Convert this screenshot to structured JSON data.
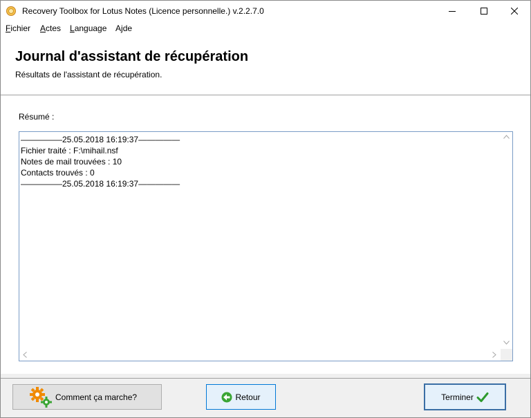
{
  "window": {
    "title": "Recovery Toolbox for Lotus Notes (Licence personnelle.) v.2.2.7.0"
  },
  "menu": [
    {
      "label": "Fichier",
      "accel": "F",
      "rest": "ichier"
    },
    {
      "label": "Actes",
      "accel": "A",
      "rest": "ctes"
    },
    {
      "label": "Language",
      "accel": "L",
      "rest": "anguage"
    },
    {
      "label": "Ajde",
      "accel": "j",
      "pre": "A",
      "rest": "de"
    }
  ],
  "header": {
    "title": "Journal d'assistant de récupération",
    "subtitle": "Résultats de l'assistant de récupération."
  },
  "summary": {
    "label": "Résumé :",
    "lines": [
      "—————25.05.2018 16:19:37—————",
      "Fichier traité : F:\\mihail.nsf",
      "Notes de mail trouvées : 10",
      "Contacts trouvés : 0",
      "—————25.05.2018 16:19:37—————"
    ]
  },
  "buttons": {
    "how_it_works": "Comment ça marche?",
    "back": "Retour",
    "finish": "Terminer"
  },
  "icons": {
    "app": "lotus-notes-app-icon",
    "how_it_works": "gears-icon",
    "back": "green-back-arrow-icon",
    "finish": "green-checkmark-icon"
  },
  "colors": {
    "log_border": "#7a9cc6",
    "focus_border": "#3a6ea5",
    "gear_orange": "#f08a00",
    "gear_green": "#3aa534",
    "check_green": "#2d9a2d"
  }
}
